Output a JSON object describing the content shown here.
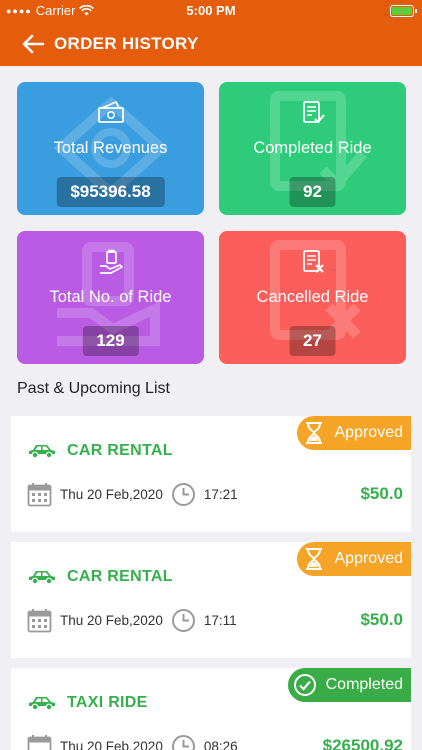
{
  "status_bar": {
    "carrier": "Carrier",
    "time": "5:00 PM"
  },
  "header": {
    "title": "ORDER HISTORY"
  },
  "stats": [
    {
      "label": "Total Revenues",
      "value": "$95396.58",
      "color": "#3a9de0",
      "icon": "money-icon"
    },
    {
      "label": "Completed Ride",
      "value": "92",
      "color": "#2ecc7a",
      "icon": "document-check-icon"
    },
    {
      "label": "Total No. of Ride",
      "value": "129",
      "color": "#b95be3",
      "icon": "hand-bag-icon"
    },
    {
      "label": "Cancelled Ride",
      "value": "27",
      "color": "#fc5f5b",
      "icon": "document-cancel-icon"
    }
  ],
  "list_title": "Past & Upcoming List",
  "orders": [
    {
      "service": "CAR RENTAL",
      "status": "Approved",
      "date": "Thu 20 Feb,2020",
      "time": "17:21",
      "price": "$50.0"
    },
    {
      "service": "CAR RENTAL",
      "status": "Approved",
      "date": "Thu 20 Feb,2020",
      "time": "17:11",
      "price": "$50.0"
    },
    {
      "service": "TAXI RIDE",
      "status": "Completed",
      "date": "Thu 20 Feb,2020",
      "time": "08:26",
      "price": "$26500.92"
    }
  ]
}
